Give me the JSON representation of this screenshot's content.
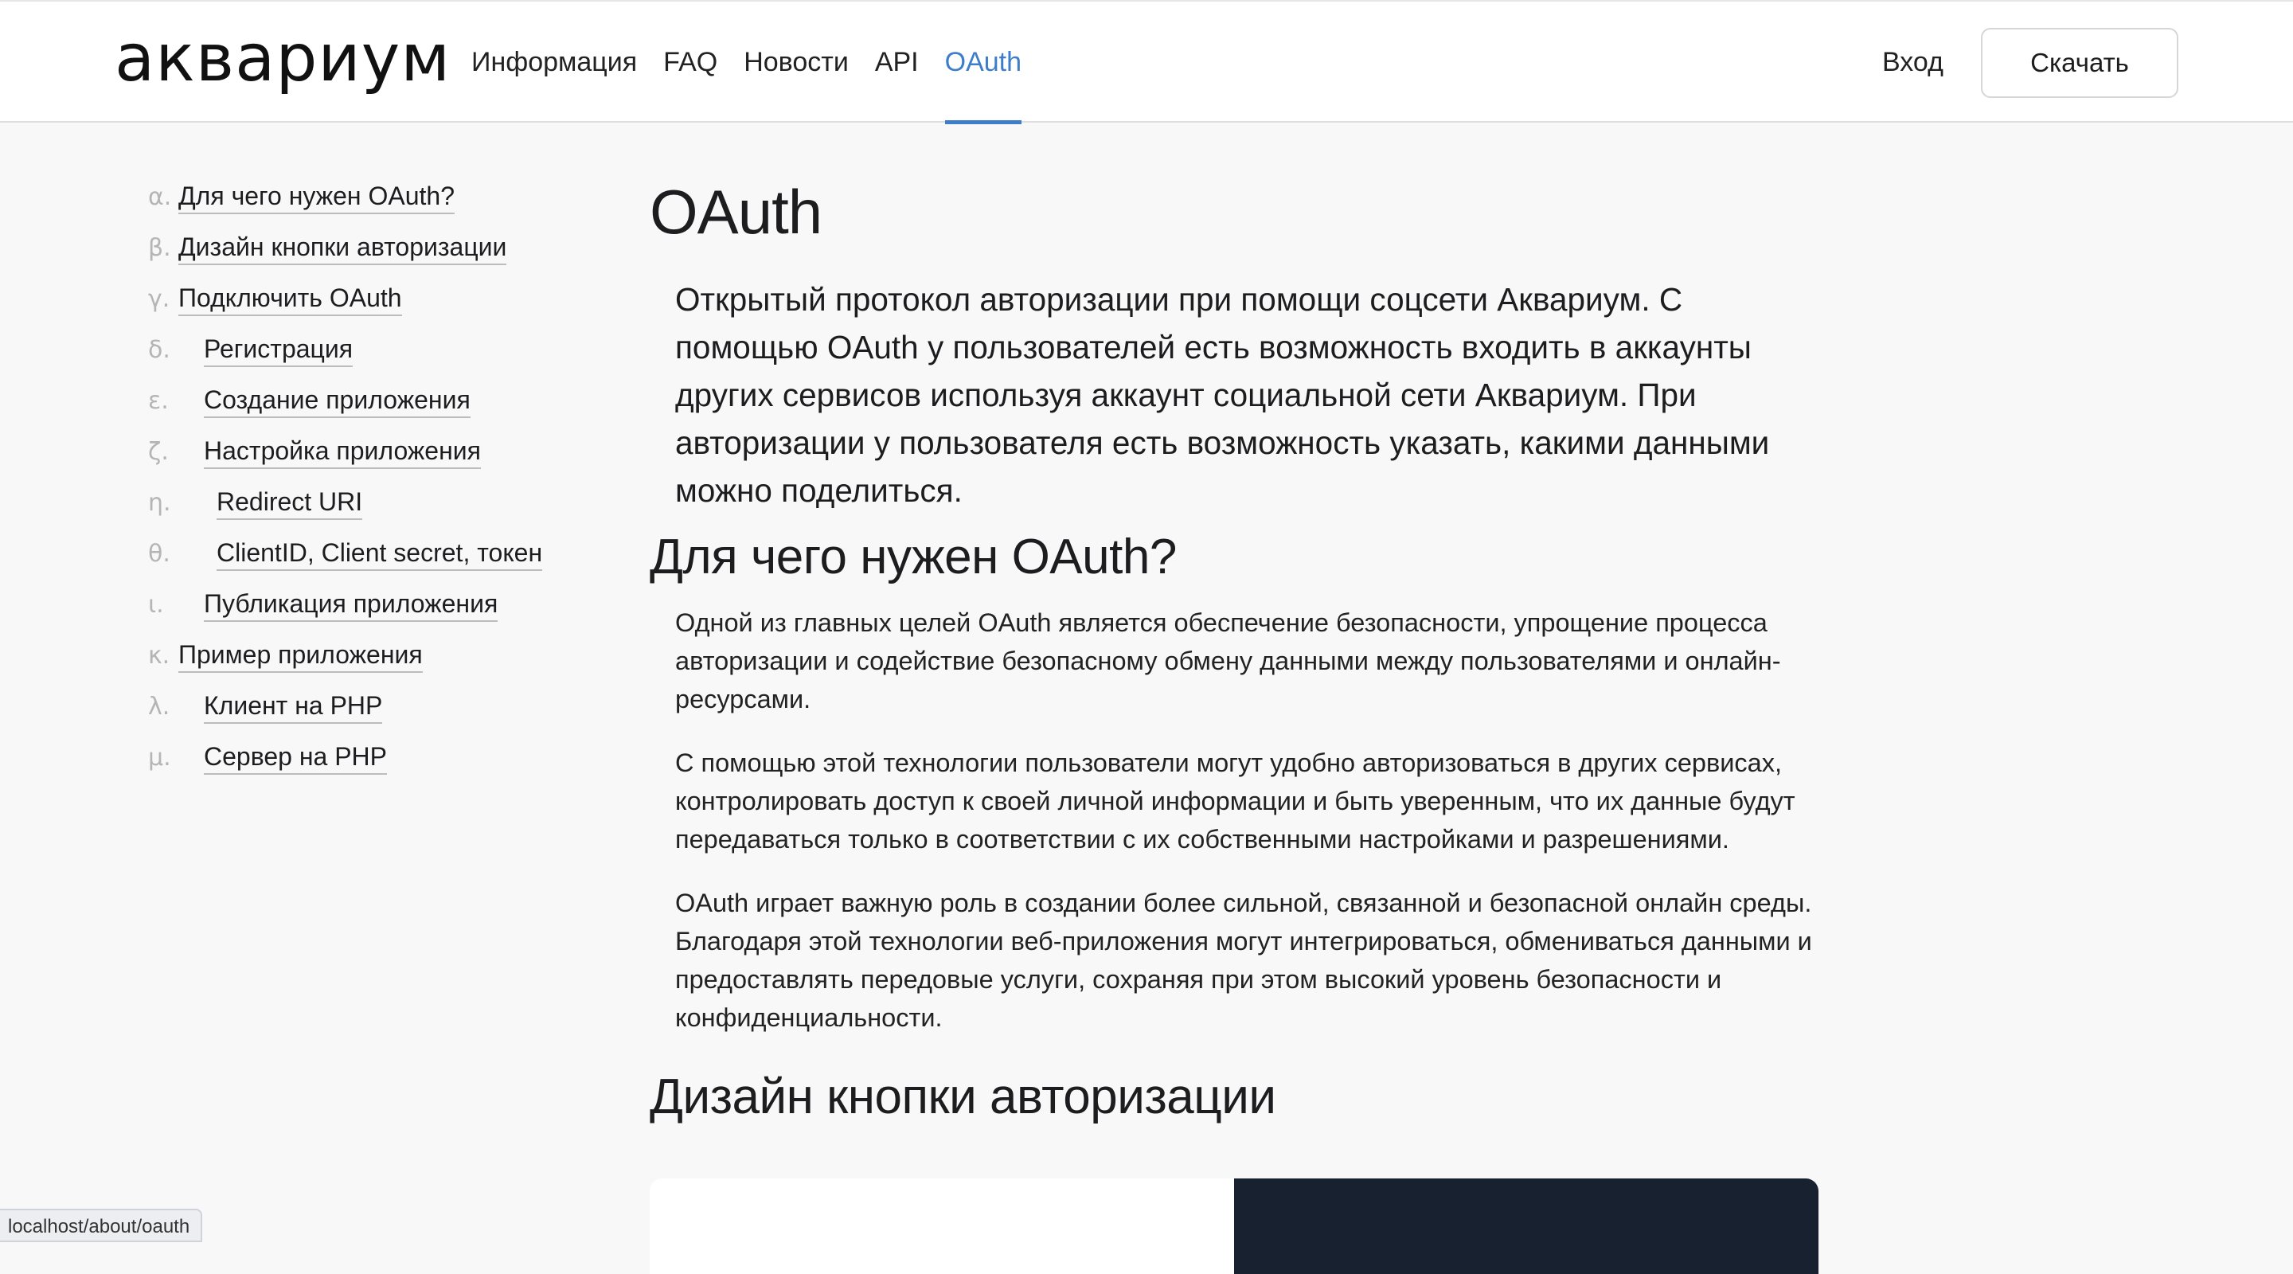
{
  "header": {
    "logo": "аквариум",
    "nav": [
      {
        "label": "Информация",
        "active": false
      },
      {
        "label": "FAQ",
        "active": false
      },
      {
        "label": "Новости",
        "active": false
      },
      {
        "label": "API",
        "active": false
      },
      {
        "label": "OAuth",
        "active": true
      }
    ],
    "login_label": "Вход",
    "download_label": "Скачать",
    "accent_color": "#3d7dca"
  },
  "toc": [
    {
      "marker": "α.",
      "label": "Для чего нужен OAuth?",
      "level": 1
    },
    {
      "marker": "β.",
      "label": "Дизайн кнопки авторизации",
      "level": 1
    },
    {
      "marker": "γ.",
      "label": "Подключить OAuth",
      "level": 1
    },
    {
      "marker": "δ.",
      "label": "Регистрация",
      "level": 2
    },
    {
      "marker": "ε.",
      "label": "Создание приложения",
      "level": 2
    },
    {
      "marker": "ζ.",
      "label": "Настройка приложения",
      "level": 2
    },
    {
      "marker": "η.",
      "label": "Redirect URI",
      "level": 3
    },
    {
      "marker": "θ.",
      "label": "ClientID, Client secret, токен",
      "level": 3
    },
    {
      "marker": "ι.",
      "label": "Публикация приложения",
      "level": 2
    },
    {
      "marker": "κ.",
      "label": "Пример приложения",
      "level": 1
    },
    {
      "marker": "λ.",
      "label": "Клиент на PHP",
      "level": 2
    },
    {
      "marker": "μ.",
      "label": "Сервер на PHP",
      "level": 2
    }
  ],
  "article": {
    "title": "OAuth",
    "lead": "Открытый протокол авторизации при помощи соцсети Аквариум. С помощью OAuth у пользователей есть возможность входить в аккаунты других сервисов используя аккаунт социальной сети Аквариум. При авторизации у пользователя есть возможность указать, какими данными можно поделиться.",
    "section1": {
      "heading": "Для чего нужен OAuth?",
      "paragraphs": [
        "Одной из главных целей OAuth является обеспечение безопасности, упрощение процесса авторизации и содействие безопасному обмену данными между пользователями и онлайн-ресурсами.",
        "С помощью этой технологии пользователи могут удобно авторизоваться в других сервисах, контролировать доступ к своей личной информации и быть уверенным, что их данные будут передаваться только в соответствии с их собственными настройками и разрешениями.",
        "OAuth играет важную роль в создании более сильной, связанной и безопасной онлайн среды. Благодаря этой технологии веб-приложения могут интегрироваться, обмениваться данными и предоставлять передовые услуги, сохраняя при этом высокий уровень безопасности и конфиденциальности."
      ]
    },
    "section2": {
      "heading": "Дизайн кнопки авторизации"
    }
  },
  "status_bar": {
    "url": "localhost/about/oauth"
  }
}
